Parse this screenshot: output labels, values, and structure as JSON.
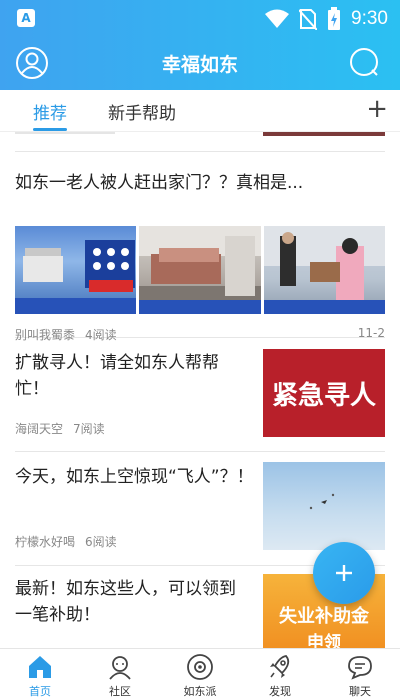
{
  "status_bar": {
    "time": "9:30"
  },
  "header": {
    "title": "幸福如东"
  },
  "tabs": [
    {
      "label": "推荐",
      "active": true
    },
    {
      "label": "新手帮助",
      "active": false
    }
  ],
  "feed": [
    {
      "headline": "如东一老人被人赶出家门？？真相是...",
      "author": "别叫我蜀黍",
      "reads": "4阅读",
      "date": "11-2"
    },
    {
      "headline": "扩散寻人！请全如东人帮帮忙！",
      "author": "海阔天空",
      "reads": "7阅读",
      "thumb_text": "紧急寻人"
    },
    {
      "headline": "今天，如东上空惊现“飞人”？！",
      "author": "柠檬水好喝",
      "reads": "6阅读"
    },
    {
      "headline": "最新！如东这些人，可以领到一笔补助！",
      "thumb_text_1": "失业补助金",
      "thumb_text_2": "申领"
    }
  ],
  "bottom_nav": [
    {
      "label": "首页",
      "active": true
    },
    {
      "label": "社区",
      "active": false
    },
    {
      "label": "如东派",
      "active": false
    },
    {
      "label": "发现",
      "active": false
    },
    {
      "label": "聊天",
      "active": false
    }
  ],
  "colors": {
    "accent": "#2b9be6",
    "header_start": "#3fa3f0",
    "header_end": "#2bc0f2"
  }
}
